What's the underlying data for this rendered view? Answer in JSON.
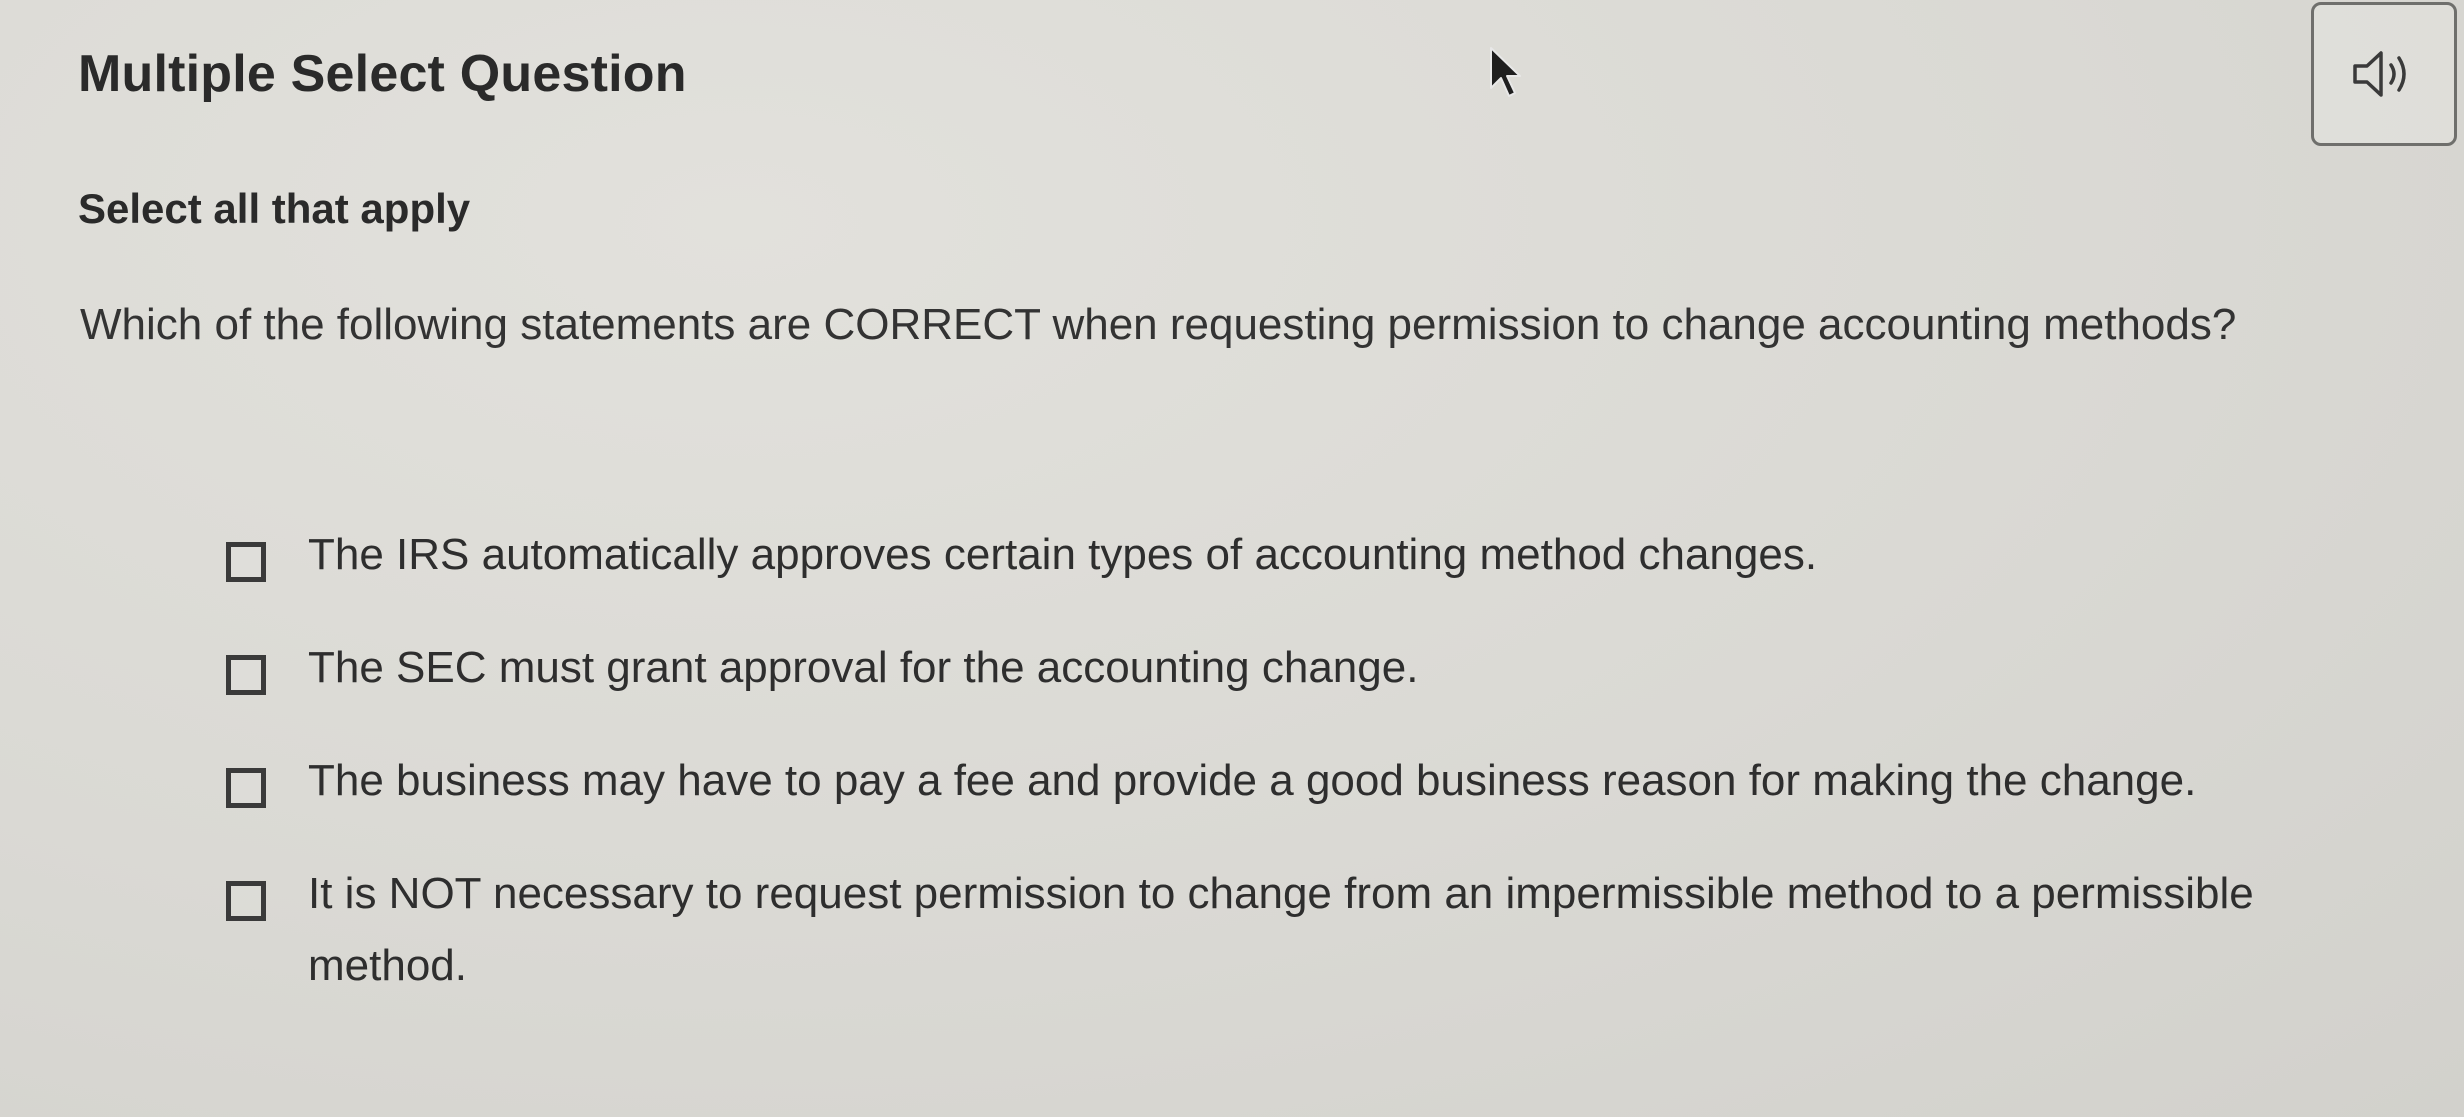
{
  "header": {
    "title": "Multiple Select Question"
  },
  "question": {
    "instruction": "Select all that apply",
    "prompt": "Which of the following statements are CORRECT when requesting permission to change accounting methods?",
    "options": [
      {
        "label": "The IRS automatically approves certain types of accounting method changes.",
        "checked": false
      },
      {
        "label": "The SEC must grant approval for the accounting change.",
        "checked": false
      },
      {
        "label": "The business may have to pay a fee and provide a good business reason for making the change.",
        "checked": false
      },
      {
        "label": "It is NOT necessary to request permission to change from an impermissible method to a permissible method.",
        "checked": false
      }
    ]
  },
  "icons": {
    "audio": "speaker-icon",
    "cursor": "mouse-pointer-icon"
  }
}
